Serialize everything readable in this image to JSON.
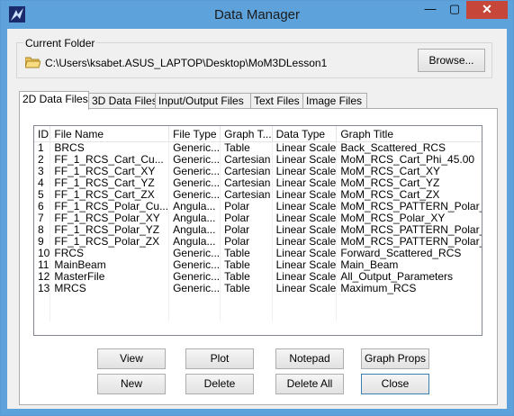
{
  "window": {
    "title": "Data Manager",
    "minimize_glyph": "—",
    "maximize_glyph": "▢",
    "close_glyph": "✕"
  },
  "current_folder": {
    "label": "Current Folder",
    "path": "C:\\Users\\ksabet.ASUS_LAPTOP\\Desktop\\MoM3DLesson1",
    "browse_label": "Browse..."
  },
  "tabs": [
    {
      "label": "2D Data Files",
      "active": true
    },
    {
      "label": "3D Data Files",
      "active": false
    },
    {
      "label": "Input/Output Files",
      "active": false
    },
    {
      "label": "Text Files",
      "active": false
    },
    {
      "label": "Image Files",
      "active": false
    }
  ],
  "table": {
    "columns": [
      "ID",
      "File Name",
      "File Type",
      "Graph T...",
      "Data Type",
      "Graph Title"
    ],
    "rows": [
      [
        "1",
        "BRCS",
        "Generic...",
        "Table",
        "Linear Scale",
        "Back_Scattered_RCS"
      ],
      [
        "2",
        "FF_1_RCS_Cart_Cu...",
        "Generic...",
        "Cartesian",
        "Linear Scale",
        "MoM_RCS_Cart_Phi_45.00"
      ],
      [
        "3",
        "FF_1_RCS_Cart_XY",
        "Generic...",
        "Cartesian",
        "Linear Scale",
        "MoM_RCS_Cart_XY"
      ],
      [
        "4",
        "FF_1_RCS_Cart_YZ",
        "Generic...",
        "Cartesian",
        "Linear Scale",
        "MoM_RCS_Cart_YZ"
      ],
      [
        "5",
        "FF_1_RCS_Cart_ZX",
        "Generic...",
        "Cartesian",
        "Linear Scale",
        "MoM_RCS_Cart_ZX"
      ],
      [
        "6",
        "FF_1_RCS_Polar_Cu...",
        "Angula...",
        "Polar",
        "Linear Scale",
        "MoM_RCS_PATTERN_Polar_C"
      ],
      [
        "7",
        "FF_1_RCS_Polar_XY",
        "Angula...",
        "Polar",
        "Linear Scale",
        "MoM_RCS_Polar_XY"
      ],
      [
        "8",
        "FF_1_RCS_Polar_YZ",
        "Angula...",
        "Polar",
        "Linear Scale",
        "MoM_RCS_PATTERN_Polar_YZ"
      ],
      [
        "9",
        "FF_1_RCS_Polar_ZX",
        "Angula...",
        "Polar",
        "Linear Scale",
        "MoM_RCS_PATTERN_Polar_ZX"
      ],
      [
        "10",
        "FRCS",
        "Generic...",
        "Table",
        "Linear Scale",
        "Forward_Scattered_RCS"
      ],
      [
        "11",
        "MainBeam",
        "Generic...",
        "Table",
        "Linear Scale",
        "Main_Beam"
      ],
      [
        "12",
        "MasterFile",
        "Generic...",
        "Table",
        "Linear Scale",
        "All_Output_Parameters"
      ],
      [
        "13",
        "MRCS",
        "Generic...",
        "Table",
        "Linear Scale",
        "Maximum_RCS"
      ]
    ]
  },
  "buttons": {
    "view": "View",
    "plot": "Plot",
    "notepad": "Notepad",
    "graph_props": "Graph Props",
    "new": "New",
    "delete": "Delete",
    "delete_all": "Delete All",
    "close": "Close"
  },
  "colors": {
    "titlebar": "#5ea2dc",
    "close": "#c7463a",
    "face": "#f0f0f0"
  }
}
